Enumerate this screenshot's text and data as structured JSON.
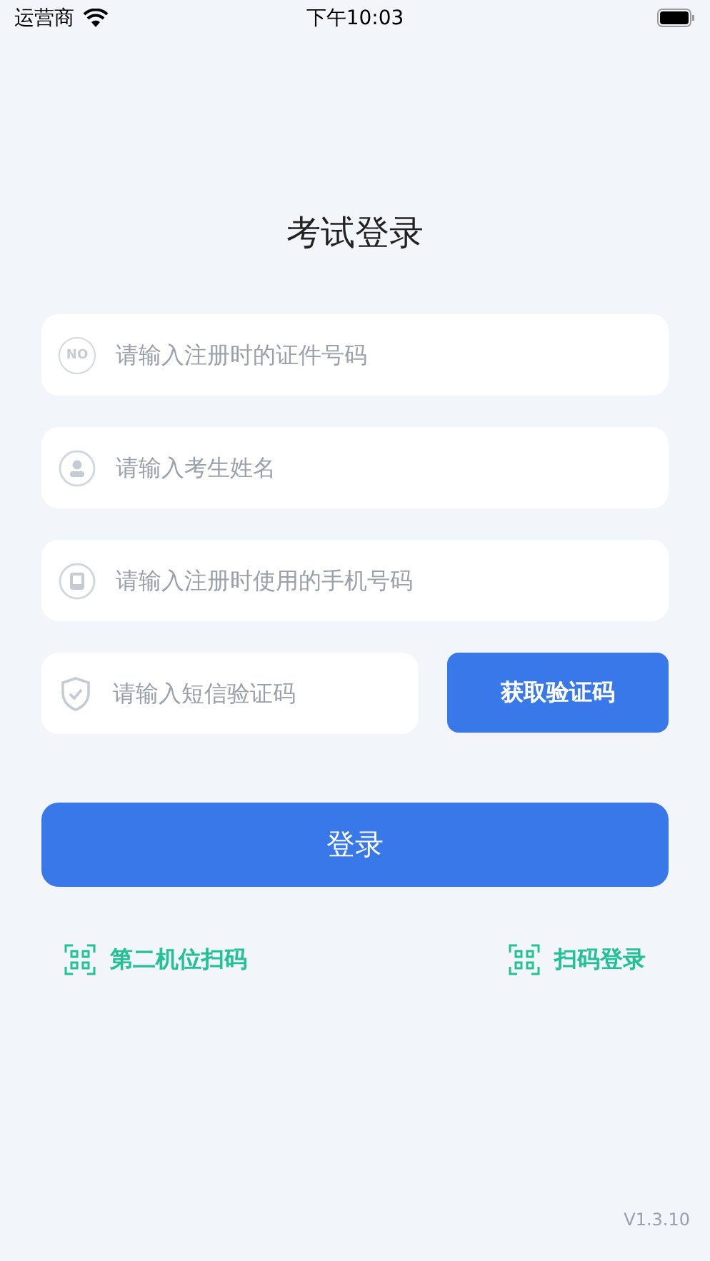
{
  "status_bar": {
    "carrier": "运营商",
    "time": "下午10:03"
  },
  "title": "考试登录",
  "fields": [
    {
      "kind": "id",
      "icon_text": "NO",
      "placeholder": "请输入注册时的证件号码"
    },
    {
      "kind": "person",
      "placeholder": "请输入考生姓名"
    },
    {
      "kind": "phone",
      "placeholder": "请输入注册时使用的手机号码"
    }
  ],
  "code_field": {
    "kind": "shield",
    "placeholder": "请输入短信验证码"
  },
  "get_code_button": "获取验证码",
  "login_button": "登录",
  "links": [
    {
      "label": "第二机位扫码"
    },
    {
      "label": "扫码登录"
    }
  ],
  "version": "V1.3.10"
}
